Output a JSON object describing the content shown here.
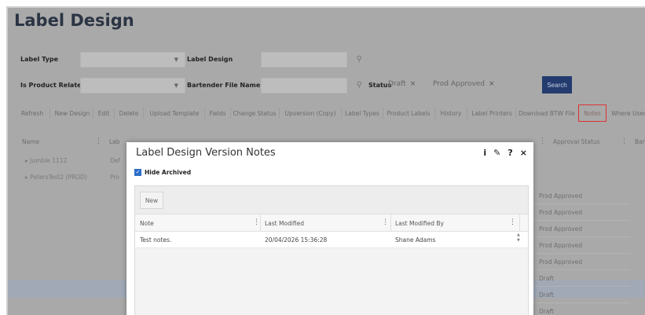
{
  "page": {
    "title": "Label Design"
  },
  "filters": {
    "label_type_label": "Label Type",
    "label_type_value": "",
    "label_design_label": "Label Design",
    "label_design_value": "",
    "is_product_related_label": "Is Product Related",
    "is_product_related_value": "",
    "bartender_file_label": "Bartender File Name",
    "bartender_file_value": "",
    "status_label": "Status",
    "status_chips": [
      "Draft",
      "Prod Approved"
    ],
    "search_label": "Search"
  },
  "toolbar": {
    "buttons": [
      "Refresh",
      "New Design",
      "Edit",
      "Delete",
      "Upload Template",
      "Fields",
      "Change Status",
      "Upversion (Copy)",
      "Label Types",
      "Product Labels",
      "History",
      "Label Printers",
      "Download BTW File",
      "Notes",
      "Where Used"
    ],
    "active": "Notes"
  },
  "grid": {
    "col_name": "Name",
    "col_label_partial": "Lab",
    "col_approval": "Approval Status",
    "col_bar_partial": "Bar",
    "tree": [
      {
        "name": "Jumble 1112",
        "partial": "Def"
      },
      {
        "name": "PetersTest2 (PROD)",
        "partial": "Pro"
      }
    ],
    "statuses": [
      "Prod Approved",
      "Prod Approved",
      "Prod Approved",
      "Prod Approved",
      "Prod Approved",
      "Draft",
      "Draft",
      "Draft"
    ]
  },
  "modal": {
    "title": "Label Design Version Notes",
    "tools": {
      "info": "i",
      "edit": "✎",
      "help": "?",
      "close": "×"
    },
    "hide_archived_label": "Hide Archived",
    "hide_archived_checked": true,
    "new_label": "New",
    "columns": [
      "Note",
      "Last Modified",
      "Last Modified By"
    ],
    "rows": [
      {
        "note": "Test notes.",
        "last_modified": "20/04/2026 15:36:28",
        "last_modified_by": "Shane Adams"
      }
    ]
  },
  "colors": {
    "accent": "#233b6e",
    "active_border": "#dd3333",
    "checkbox": "#2d6ec9"
  }
}
